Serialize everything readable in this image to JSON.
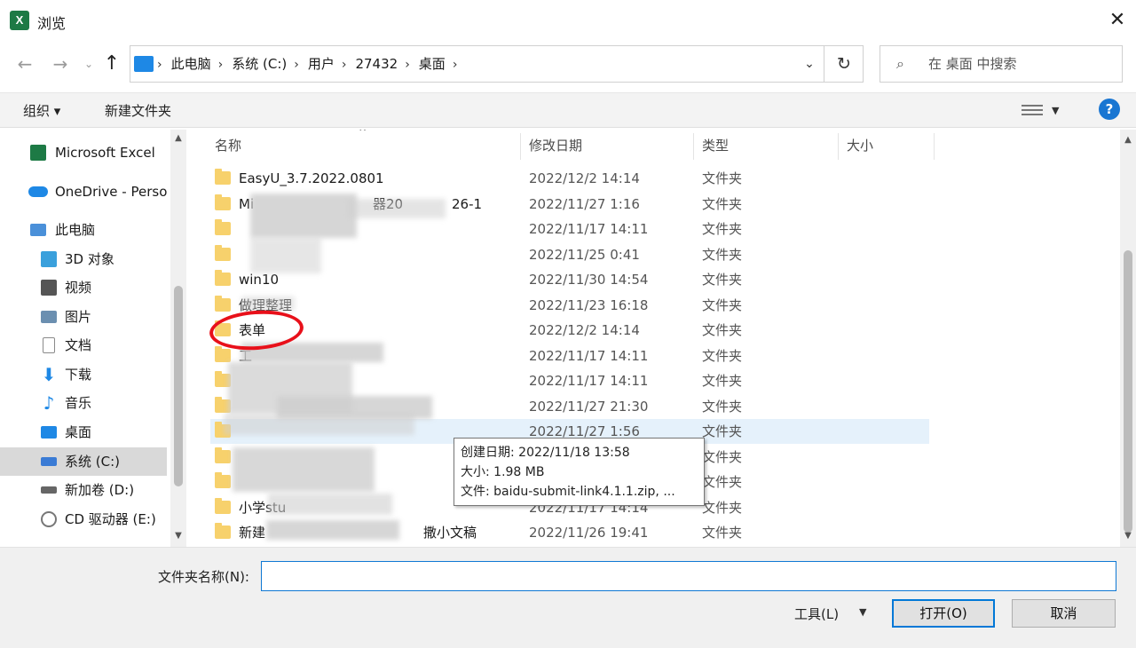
{
  "window": {
    "title": "浏览",
    "app_icon_letter": "X"
  },
  "nav": {
    "back": "←",
    "forward": "→",
    "recent": "⌄",
    "up": "↑"
  },
  "address": {
    "crumbs": [
      "此电脑",
      "系统 (C:)",
      "用户",
      "27432",
      "桌面"
    ],
    "separator": "›",
    "dropdown": "⌄",
    "refresh": "↻"
  },
  "search": {
    "placeholder": "在 桌面 中搜索",
    "icon": "⌕"
  },
  "toolbar": {
    "organize": "组织 ▾",
    "new_folder": "新建文件夹",
    "view_dropdown": "▼",
    "help": "?"
  },
  "sidebar": {
    "items": [
      {
        "label": "Microsoft Excel",
        "icon": "excel-icon",
        "color": "#1d7a45"
      },
      {
        "label": "OneDrive - Perso",
        "icon": "onedrive-icon",
        "color": "#1e88e5"
      },
      {
        "label": "此电脑",
        "icon": "computer-icon",
        "color": "#4a90d9"
      },
      {
        "label": "3D 对象",
        "icon": "3d-objects-icon",
        "color": "#3aa0dc"
      },
      {
        "label": "视频",
        "icon": "video-icon",
        "color": "#555555"
      },
      {
        "label": "图片",
        "icon": "pictures-icon",
        "color": "#6b8fb0"
      },
      {
        "label": "文档",
        "icon": "documents-icon",
        "color": "#8a8a8a"
      },
      {
        "label": "下载",
        "icon": "downloads-icon",
        "color": "#1e88e5"
      },
      {
        "label": "音乐",
        "icon": "music-icon",
        "color": "#1e88e5"
      },
      {
        "label": "桌面",
        "icon": "desktop-icon",
        "color": "#1e88e5"
      },
      {
        "label": "系统 (C:)",
        "icon": "drive-icon",
        "color": "#3a7bd5"
      },
      {
        "label": "新加卷 (D:)",
        "icon": "drive-icon",
        "color": "#666666"
      },
      {
        "label": "CD 驱动器 (E:)",
        "icon": "cd-drive-icon",
        "color": "#777777"
      }
    ]
  },
  "columns": {
    "name": "名称",
    "modified": "修改日期",
    "type": "类型",
    "size": "大小",
    "sort_indicator": "^"
  },
  "files": [
    {
      "name": "EasyU_3.7.2022.0801",
      "date": "2022/12/2 14:14",
      "type": "文件夹"
    },
    {
      "name": "Mi",
      "name_tail": "器20",
      "name_end": "26-1",
      "date": "2022/11/27 1:16",
      "type": "文件夹"
    },
    {
      "name": "",
      "date": "2022/11/17 14:11",
      "type": "文件夹"
    },
    {
      "name": "",
      "date": "2022/11/25 0:41",
      "type": "文件夹"
    },
    {
      "name": "win10",
      "date": "2022/11/30 14:54",
      "type": "文件夹"
    },
    {
      "name": "做理整理",
      "date": "2022/11/23 16:18",
      "type": "文件夹"
    },
    {
      "name": "表单",
      "date": "2022/12/2 14:14",
      "type": "文件夹"
    },
    {
      "name": "工",
      "date": "2022/11/17 14:11",
      "type": "文件夹"
    },
    {
      "name": "",
      "date": "2022/11/17 14:11",
      "type": "文件夹"
    },
    {
      "name": "",
      "date": "2022/11/27 21:30",
      "type": "文件夹"
    },
    {
      "name": "",
      "date": "2022/11/27 1:56",
      "type": "文件夹"
    },
    {
      "name": "",
      "date": "",
      "type": "文件夹"
    },
    {
      "name": "",
      "date": "",
      "type": "文件夹"
    },
    {
      "name": "小学stu",
      "date": "2022/11/17 14:14",
      "type": "文件夹"
    },
    {
      "name": "新建",
      "name_tail": "撒小文稿",
      "date": "2022/11/26 19:41",
      "type": "文件夹"
    }
  ],
  "tooltip": {
    "created": "创建日期: 2022/11/18 13:58",
    "size": "大小: 1.98 MB",
    "files": "文件: baidu-submit-link4.1.1.zip, ..."
  },
  "footer": {
    "folder_name_label": "文件夹名称(N):",
    "folder_name_value": "",
    "tools_label": "工具(L)",
    "tools_dropdown": "▼",
    "open_label": "打开(O)",
    "cancel_label": "取消"
  },
  "annotation_color": "#e8101a"
}
